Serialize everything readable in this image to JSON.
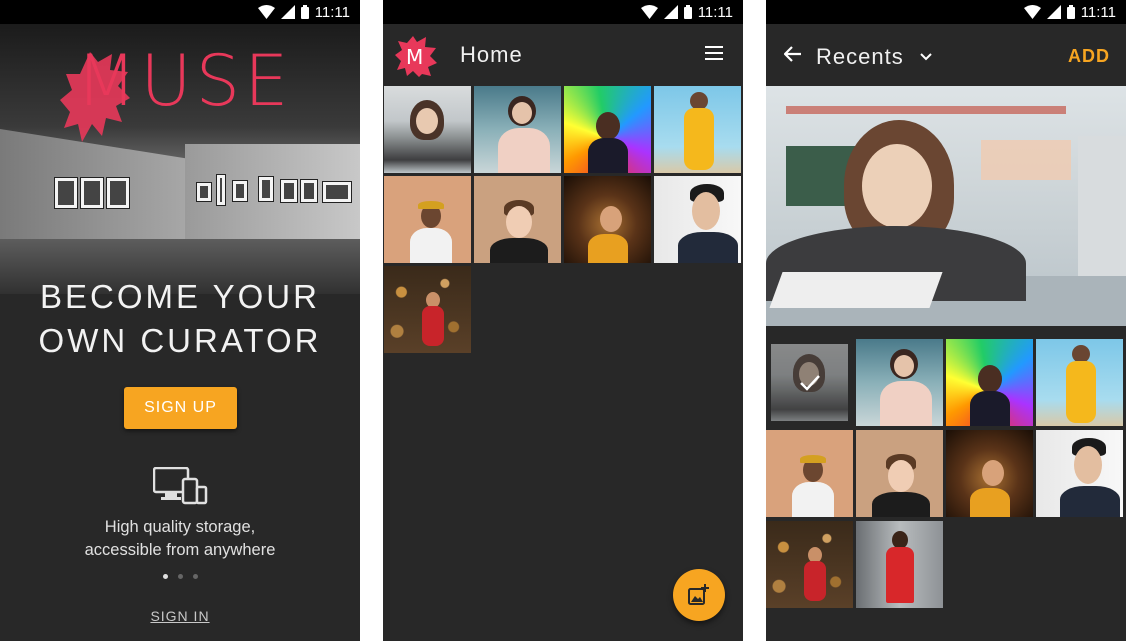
{
  "status_bar": {
    "time": "11:11"
  },
  "screen1": {
    "logo": "MUSE",
    "headline_line1": "BECOME YOUR",
    "headline_line2": "OWN CURATOR",
    "signup_label": "SIGN UP",
    "feature_line1": "High quality storage,",
    "feature_line2": "accessible from anywhere",
    "pager": {
      "count": 3,
      "active": 1
    },
    "signin_label": "SIGN IN"
  },
  "screen2": {
    "title": "Home",
    "icons": {
      "logo": "muse-logo-icon",
      "menu": "menu-icon",
      "fab": "add-photo-icon"
    },
    "photos": [
      "girl-studying-photo",
      "woman-laptop-photo",
      "colorful-portrait-photo",
      "yellow-outfit-photo",
      "man-cap-photo",
      "young-man-photo",
      "woman-hair-photo",
      "man-portrait-photo",
      "woman-bokeh-photo"
    ]
  },
  "screen3": {
    "title": "Recents",
    "add_label": "ADD",
    "icons": {
      "back": "arrow-back-icon",
      "dropdown": "chevron-down-icon",
      "check": "check-icon"
    },
    "photos": [
      "girl-studying-photo",
      "woman-laptop-photo",
      "colorful-portrait-photo",
      "yellow-outfit-photo",
      "man-cap-photo",
      "young-man-photo",
      "woman-hair-photo",
      "man-portrait-photo",
      "woman-bokeh-photo",
      "woman-red-coat-photo"
    ],
    "selected_index": 0
  },
  "colors": {
    "accent": "#f7a521",
    "logo": "#e8385a",
    "background": "#282828",
    "status_bar": "#000000"
  }
}
